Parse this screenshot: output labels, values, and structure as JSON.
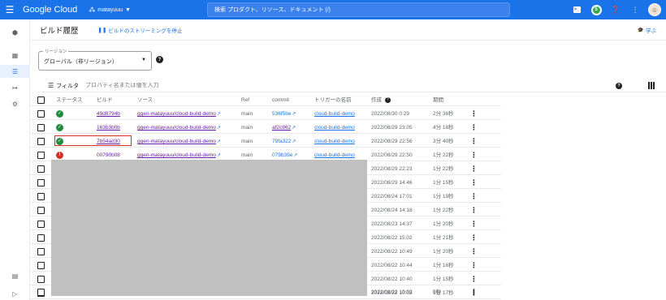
{
  "topbar": {
    "menu_icon": "hamburger-icon",
    "logo": "Google Cloud",
    "project": "matayuuu",
    "search_placeholder": "検索 プロダクト、リソース、ドキュメント (/)",
    "right_icons": [
      "cloud-shell-icon",
      "notifications-icon",
      "help-icon",
      "more-vert-icon",
      "avatar"
    ]
  },
  "header": {
    "title": "ビルド履歴",
    "stream_link": "ビルドのストリーミングを停止",
    "learn": "学ぶ"
  },
  "region": {
    "label": "リージョン",
    "value": "グローバル（非リージョン）"
  },
  "filter": {
    "label": "フィルタ",
    "placeholder": "プロパティ名または値を入力"
  },
  "table": {
    "columns": [
      "ステータス",
      "ビルド",
      "ソース",
      "Ref",
      "commit",
      "トリガーの名前",
      "作成",
      "期間"
    ],
    "rows": [
      {
        "status": "success",
        "build": "49d8794b",
        "source": "ggen-matayuuu/cloud-build-demo",
        "ref": "main",
        "commit": "536f5be",
        "trigger": "cloud-build-demo",
        "created": "2022/08/30 0:29",
        "duration": "2分 36秒"
      },
      {
        "status": "success",
        "build": "163b3b0b",
        "source": "ggen-matayuuu/cloud-build-demo",
        "ref": "main",
        "commit": "af2c862",
        "trigger": "cloud-build-demo",
        "created": "2022/08/29 23:05",
        "duration": "4分 18秒"
      },
      {
        "status": "success",
        "build": "7b54ad30",
        "source": "ggen-matayuuu/cloud-build-demo",
        "ref": "main",
        "commit": "79fa322",
        "trigger": "cloud-build-demo",
        "created": "2022/08/29 22:56",
        "duration": "3分 40秒"
      },
      {
        "status": "error",
        "build": "00790b08",
        "source": "ggen-matayuuu/cloud-build-demo",
        "ref": "main",
        "commit": "079b39e",
        "trigger": "cloud-build-demo",
        "created": "2022/08/29 22:50",
        "duration": "1分 22秒"
      },
      {
        "created": "2022/08/29 22:23",
        "duration": "1分 22秒"
      },
      {
        "created": "2022/08/29 14:46",
        "duration": "1分 15秒"
      },
      {
        "created": "2022/08/24 17:01",
        "duration": "1分 19秒"
      },
      {
        "created": "2022/08/24 14:18",
        "duration": "1分 22秒"
      },
      {
        "created": "2022/08/23 14:37",
        "duration": "1分 20秒"
      },
      {
        "created": "2022/08/22 15:02",
        "duration": "1分 21秒"
      },
      {
        "created": "2022/08/22 10:49",
        "duration": "1分 20秒"
      },
      {
        "created": "2022/08/22 10:44",
        "duration": "1分 16秒"
      },
      {
        "created": "2022/08/22 10:40",
        "duration": "1分 15秒"
      },
      {
        "created": "2022/08/22 10:03",
        "duration": "1分 17秒"
      },
      {
        "created": "2022/08/22 10:02",
        "duration": "0秒"
      }
    ]
  },
  "colors": {
    "brand_blue": "#1a73e8",
    "success_green": "#1e8e3e",
    "error_red": "#d93025",
    "visited_link": "#681da8"
  }
}
